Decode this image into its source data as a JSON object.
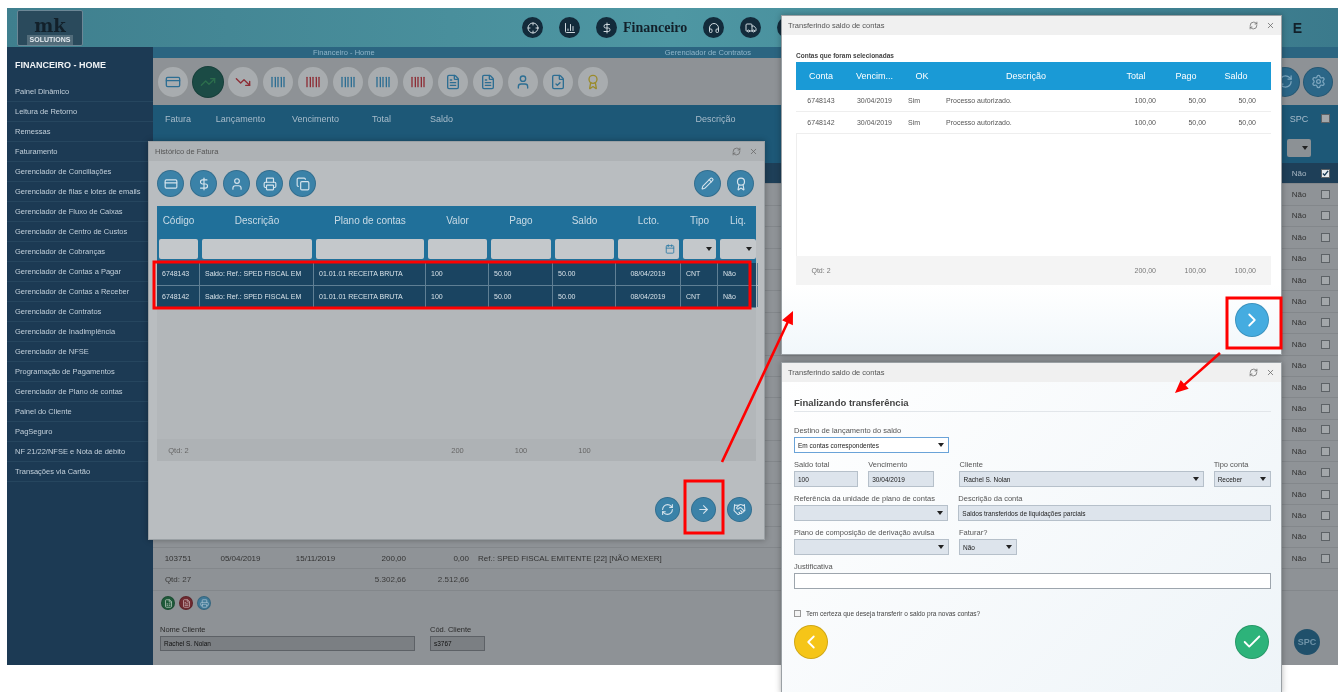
{
  "header": {
    "logo_mark": "mk",
    "logo_text": "SOLUTIONS",
    "module": "Financeiro",
    "fragment": "E"
  },
  "sidebar": {
    "title": "FINANCEIRO - HOME",
    "items": [
      "Painel Dinâmico",
      "Leitura de Retorno",
      "Remessas",
      "Faturamento",
      "Gerenciador de Conciliações",
      "Gerenciador de filas e lotes de emails",
      "Gerenciador de Fluxo de Caixas",
      "Gerenciador de Centro de Custos",
      "Gerenciador de Cobranças",
      "Gerenciador de Contas a Pagar",
      "Gerenciador de Contas a Receber",
      "Gerenciador de Contratos",
      "Gerenciador de Inadimplência",
      "Gerenciador de NFSE",
      "Programação de Pagamentos",
      "Gerenciador de Plano de contas",
      "Painel do Cliente",
      "PagSeguro",
      "NF 21/22/NFSE e Nota de débito",
      "Transações via Cartão"
    ]
  },
  "breadcrumbs": [
    "Financeiro - Home",
    "Gerenciador de Contratos"
  ],
  "main_table": {
    "columns": [
      "Fatura",
      "Lançamento",
      "Vencimento",
      "Total",
      "Saldo",
      "Descrição"
    ],
    "spc_column": "SPC",
    "select_all_checked": false,
    "rows": [
      {
        "selected": true,
        "checked": true,
        "spc": "Não"
      },
      {
        "selected": false,
        "checked": false,
        "spc": "Não"
      },
      {
        "selected": false,
        "checked": false,
        "spc": "Não"
      },
      {
        "selected": false,
        "checked": false,
        "spc": "Não"
      },
      {
        "selected": false,
        "checked": false,
        "spc": "Não"
      },
      {
        "selected": false,
        "checked": false,
        "spc": "Não"
      },
      {
        "selected": false,
        "checked": false,
        "spc": "Não"
      },
      {
        "selected": false,
        "checked": false,
        "spc": "Não"
      },
      {
        "selected": false,
        "checked": false,
        "spc": "Não"
      },
      {
        "selected": false,
        "checked": false,
        "spc": "Não"
      },
      {
        "selected": false,
        "checked": false,
        "spc": "Não"
      },
      {
        "selected": false,
        "checked": false,
        "spc": "Não"
      },
      {
        "selected": false,
        "checked": false,
        "spc": "Não"
      },
      {
        "selected": false,
        "checked": false,
        "spc": "Não"
      },
      {
        "selected": false,
        "checked": false,
        "spc": "Não"
      },
      {
        "selected": false,
        "checked": false,
        "spc": "Não"
      },
      {
        "selected": false,
        "checked": false,
        "spc": "Não"
      },
      {
        "selected": false,
        "checked": false,
        "spc": "Não"
      },
      {
        "selected": false,
        "checked": false,
        "spc": "Não",
        "cells": [
          "103751",
          "05/04/2019",
          "15/11/2019",
          "200,00",
          "0,00",
          "Ref.: SPED FISCAL EMITENTE [22] [NÃO MEXER]"
        ]
      }
    ],
    "totals": {
      "label": "Qtd: 27",
      "total": "5.302,66",
      "saldo": "2.512,66"
    }
  },
  "customer": {
    "name_label": "Nome Cliente",
    "name": "Rachel S. Nolan",
    "code_label": "Cód. Cliente",
    "code": "s3767"
  },
  "spc_button": "SPC",
  "history": {
    "title": "Histórico de Fatura",
    "columns": [
      "Código",
      "Descrição",
      "Plano de contas",
      "Valor",
      "Pago",
      "Saldo",
      "Lcto.",
      "Tipo",
      "Liq."
    ],
    "rows": [
      {
        "selected": true,
        "cells": [
          "6748143",
          "Saldo: Ref.: SPED FISCAL EM",
          "01.01.01 RECEITA BRUTA",
          "100",
          "50.00",
          "50.00",
          "08/04/2019",
          "CNT",
          "Não"
        ]
      },
      {
        "selected": true,
        "cells": [
          "6748142",
          "Saldo: Ref.: SPED FISCAL EM",
          "01.01.01 RECEITA BRUTA",
          "100",
          "50.00",
          "50.00",
          "08/04/2019",
          "CNT",
          "Não"
        ]
      }
    ],
    "footer": {
      "label": "Qtd: 2",
      "valor": "200",
      "pago": "100",
      "saldo": "100"
    }
  },
  "transfer_list": {
    "title": "Transferindo saldo de contas",
    "caption": "Contas que foram selecionadas",
    "columns": [
      "Conta",
      "Vencim...",
      "OK",
      "Descrição",
      "Total",
      "Pago",
      "Saldo"
    ],
    "rows": [
      [
        "6748143",
        "30/04/2019",
        "Sim",
        "Processo autorizado.",
        "100,00",
        "50,00",
        "50,00"
      ],
      [
        "6748142",
        "30/04/2019",
        "Sim",
        "Processo autorizado.",
        "100,00",
        "50,00",
        "50,00"
      ]
    ],
    "footer": {
      "label": "Qtd: 2",
      "total": "200,00",
      "pago": "100,00",
      "saldo": "100,00"
    }
  },
  "transfer_final": {
    "title": "Transferindo saldo de contas",
    "heading": "Finalizando transferência",
    "form_rows": [
      [
        {
          "label": "Destino de lançamento do saldo",
          "value": "Em contas correspondentes",
          "kind": "select",
          "disabled": false
        }
      ],
      [
        {
          "label": "Saldo total",
          "value": "100",
          "kind": "text",
          "disabled": true
        },
        {
          "label": "Vencimento",
          "value": "30/04/2019",
          "kind": "text",
          "disabled": true
        },
        {
          "label": "Cliente",
          "value": "Rachel S. Nolan",
          "kind": "select",
          "disabled": true
        },
        {
          "label": "Tipo conta",
          "value": "Receber",
          "kind": "select",
          "disabled": true
        }
      ],
      [
        {
          "label": "Referência da unidade de plano de contas",
          "kind": "select",
          "disabled": true
        },
        {
          "label": "Descrição da conta",
          "value": "Saldos transferidos de liquidações parciais",
          "kind": "text",
          "disabled": true
        }
      ],
      [
        {
          "label": "Plano de composição de derivação avulsa",
          "kind": "select",
          "disabled": true
        },
        {
          "label": "Faturar?",
          "value": "Não",
          "kind": "select",
          "disabled": true
        }
      ],
      [
        {
          "label": "Justificativa",
          "kind": "text",
          "disabled": false
        }
      ]
    ],
    "confirm": {
      "label": "Tem certeza que deseja transferir o saldo pra novas contas?",
      "checked": false
    }
  }
}
